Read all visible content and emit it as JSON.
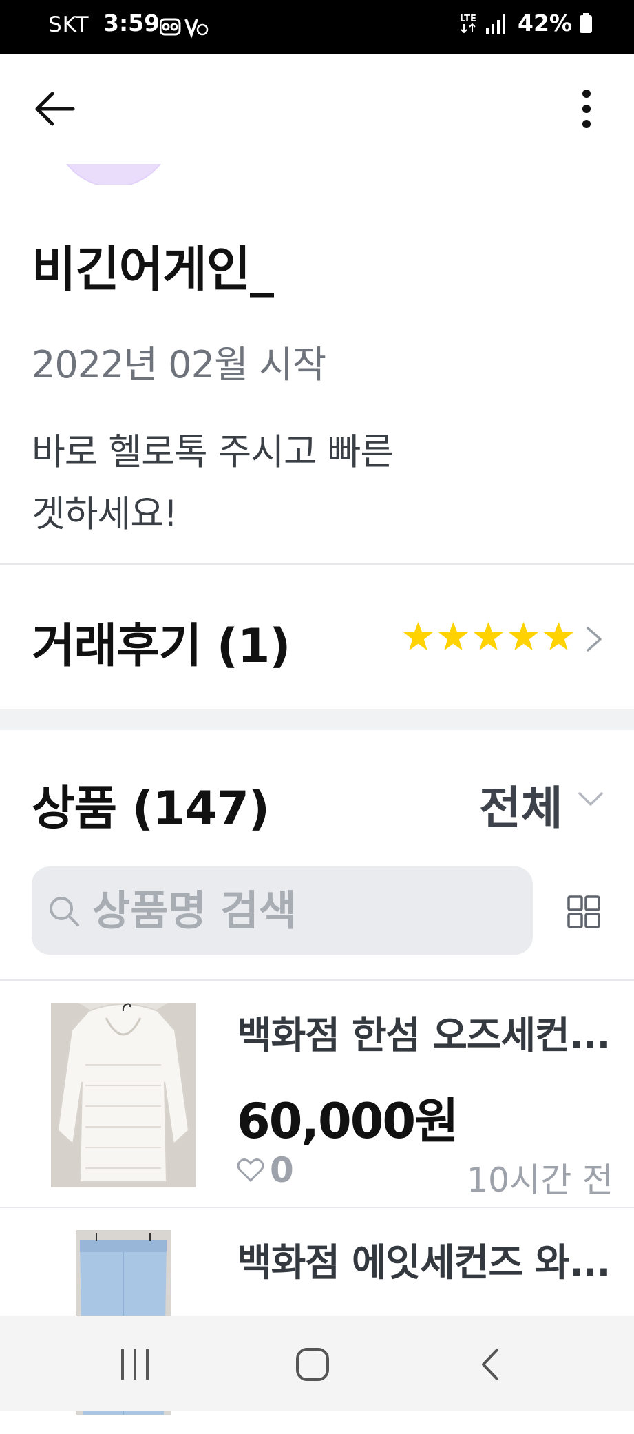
{
  "status_bar": {
    "carrier": "SKT",
    "time": "3:59",
    "network": "LTE",
    "battery": "42%"
  },
  "profile": {
    "name": "비긴어게인_",
    "since": "2022년 02월 시작",
    "bio_line1": "바로 헬로톡 주시고 빠른",
    "bio_line2": "겟하세요!"
  },
  "reviews": {
    "label": "거래후기 (1)",
    "rating": 5,
    "max_rating": 5,
    "star_color": "#FFD200"
  },
  "products": {
    "label": "상품 (147)",
    "filter": "전체",
    "search_placeholder": "상품명 검색",
    "items": [
      {
        "title": "백화점 한섬 오즈세컨...",
        "price": "60,000원",
        "likes": "0",
        "time": "10시간 전"
      },
      {
        "title": "백화점 에잇세컨즈 와...",
        "price": "",
        "likes": "",
        "time": ""
      }
    ]
  },
  "icons": {
    "back": "back-arrow-icon",
    "more": "more-vertical-icon",
    "chevron": "chevron-right-icon",
    "search": "search-icon",
    "grid": "grid-view-icon",
    "heart": "heart-outline-icon"
  }
}
